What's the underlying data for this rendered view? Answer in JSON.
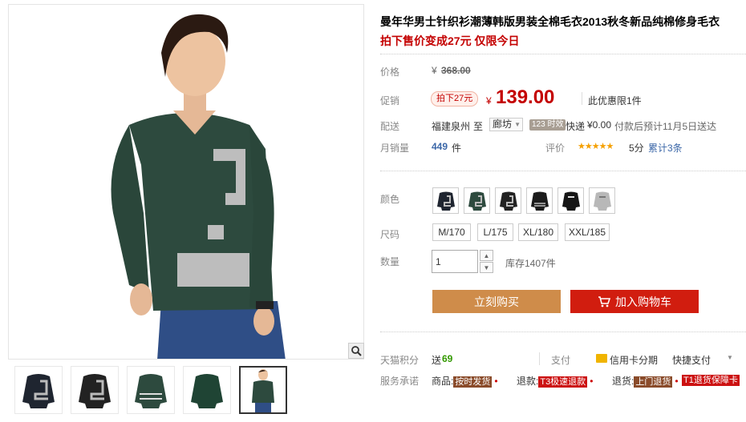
{
  "product": {
    "title": "曼年华男士针织衫潮薄韩版男装全棉毛衣2013秋冬新品纯棉修身毛衣",
    "subtitle": "拍下售价变成27元 仅限今日"
  },
  "price": {
    "label": "价格",
    "currency": "¥",
    "original": "368.00"
  },
  "promo": {
    "label": "促销",
    "tag": "拍下27元",
    "currency": "¥",
    "price": "139.00",
    "note": "此优惠限1件"
  },
  "shipping": {
    "label": "配送",
    "from": "福建泉州",
    "to_word": "至",
    "destination": "廊坊",
    "time_badge": "123 时效",
    "method": "快递",
    "fee": "¥0.00",
    "eta": "付款后预计11月5日送达"
  },
  "sales": {
    "label": "月销量",
    "count": "449",
    "unit": "件",
    "rating_label": "评价",
    "stars": "★★★★★",
    "score": "5分",
    "reviews": "累计3条"
  },
  "color": {
    "label": "颜色",
    "options": [
      "navy-z",
      "green-z",
      "black-z",
      "black-stripe",
      "black-logo",
      "grey-logo"
    ]
  },
  "size": {
    "label": "尺码",
    "options": [
      "M/170",
      "L/175",
      "XL/180",
      "XXL/185"
    ]
  },
  "quantity": {
    "label": "数量",
    "value": "1",
    "stock": "库存1407件"
  },
  "buttons": {
    "buy_now": "立刻购买",
    "add_to_cart": "加入购物车"
  },
  "points": {
    "label": "天猫积分",
    "prefix": "送",
    "value": "69",
    "pay_label": "支付",
    "credit": "信用卡分期",
    "quick_pay": "快捷支付"
  },
  "service": {
    "label": "服务承诺",
    "goods_label": "商品:",
    "goods_tag": "按时发货",
    "refund_label": "退款:",
    "refund_tag": "T3极速退款",
    "return_label": "退货:",
    "return_tag": "上门退货",
    "t1_tag": "T1退货保障卡"
  },
  "icons": {
    "zoom": "magnifier-icon",
    "cart": "cart-icon",
    "dropdown": "chevron-down-icon"
  },
  "colors": {
    "accent_red": "#c40000",
    "buy_now": "#cf8c4a",
    "add_cart": "#d11d0f",
    "green": "#339900"
  }
}
